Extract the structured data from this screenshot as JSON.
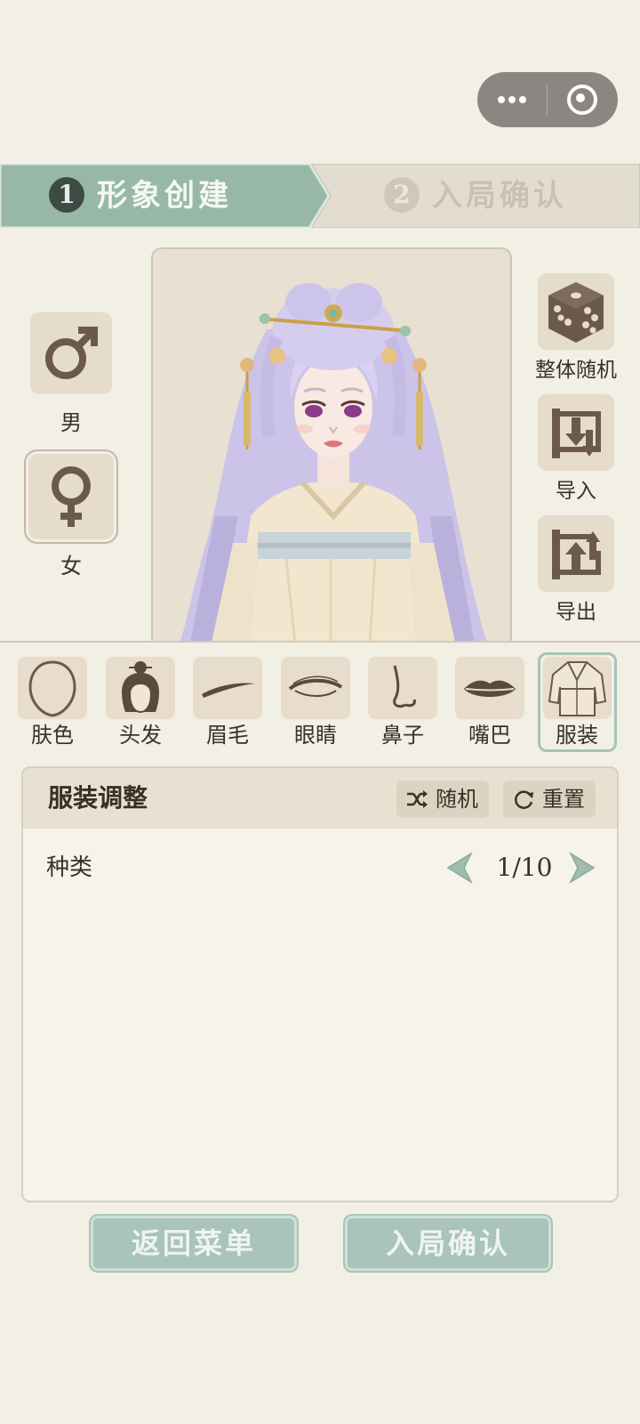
{
  "steps": [
    {
      "number": "1",
      "label": "形象创建"
    },
    {
      "number": "2",
      "label": "入局确认"
    }
  ],
  "gender": {
    "male_label": "男",
    "female_label": "女"
  },
  "actions": {
    "random_label": "整体随机",
    "import_label": "导入",
    "export_label": "导出"
  },
  "features": [
    {
      "label": "肤色",
      "icon": "face-outline-icon"
    },
    {
      "label": "头发",
      "icon": "hair-bun-icon"
    },
    {
      "label": "眉毛",
      "icon": "eyebrow-icon"
    },
    {
      "label": "眼睛",
      "icon": "eye-icon"
    },
    {
      "label": "鼻子",
      "icon": "nose-icon"
    },
    {
      "label": "嘴巴",
      "icon": "lips-icon"
    },
    {
      "label": "服装",
      "icon": "robe-icon"
    }
  ],
  "panel": {
    "title": "服装调整",
    "random_label": "随机",
    "reset_label": "重置",
    "row_label": "种类",
    "pager": "1/10"
  },
  "bottom": {
    "back_label": "返回菜单",
    "confirm_label": "入局确认"
  },
  "colors": {
    "background": "#f2efe5",
    "step_active": "#97b8a6",
    "step_inactive": "#e3ddd1",
    "button_green": "#a9c4b8",
    "icon_brown": "#6b5a4b"
  }
}
